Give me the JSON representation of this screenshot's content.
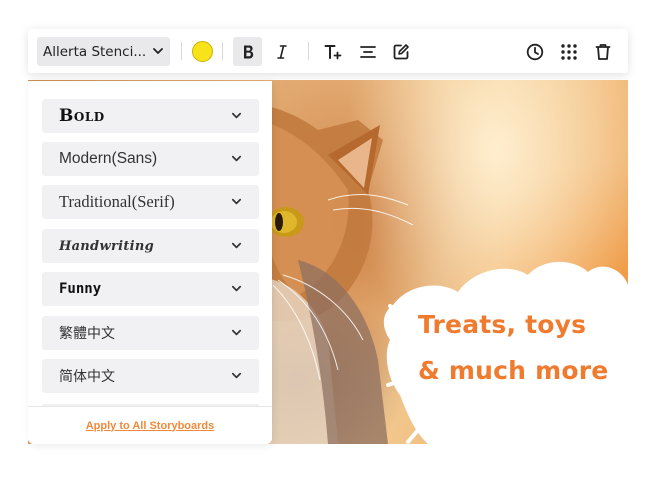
{
  "toolbar": {
    "font_name": "Allerta Stenci...",
    "text_color": "#f8e31b",
    "buttons": [
      "bold",
      "italic",
      "text-size",
      "align",
      "edit",
      "history",
      "grid",
      "delete"
    ]
  },
  "font_panel": {
    "items": [
      {
        "label": "Bold"
      },
      {
        "label": "Modern(Sans)"
      },
      {
        "label": "Traditional(Serif)"
      },
      {
        "label": "Handwriting"
      },
      {
        "label": "Funny"
      },
      {
        "label": "繁體中文"
      },
      {
        "label": "简体中文"
      }
    ],
    "apply_label": "Apply to All Storyboards"
  },
  "callout": {
    "line1": "Treats, toys",
    "line2": "& much more",
    "color": "#f07b2e"
  }
}
